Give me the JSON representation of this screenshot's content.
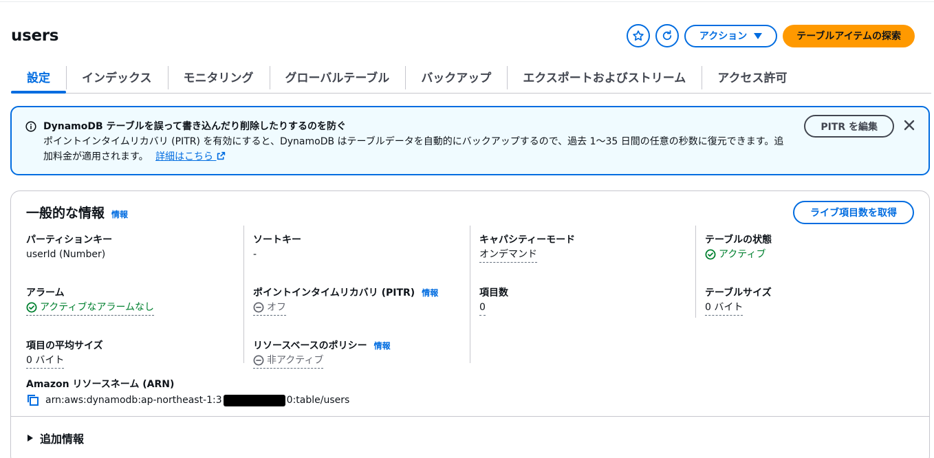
{
  "page": {
    "title": "users"
  },
  "header": {
    "favorite_icon": "star-icon",
    "refresh_icon": "refresh-icon",
    "actions_label": "アクション",
    "explore_label": "テーブルアイテムの探索"
  },
  "tabs": [
    {
      "label": "設定",
      "active": true
    },
    {
      "label": "インデックス"
    },
    {
      "label": "モニタリング"
    },
    {
      "label": "グローバルテーブル"
    },
    {
      "label": "バックアップ"
    },
    {
      "label": "エクスポートおよびストリーム"
    },
    {
      "label": "アクセス許可"
    }
  ],
  "alert": {
    "title": "DynamoDB テーブルを誤って書き込んだり削除したりするのを防ぐ",
    "body": "ポイントインタイムリカバリ (PITR) を有効にすると、DynamoDB はテーブルデータを自動的にバックアップするので、過去 1〜35 日間の任意の秒数に復元できます。追加料金が適用されます。",
    "link": "詳細はこちら",
    "edit_button": "PITR を編集"
  },
  "general": {
    "title": "一般的な情報",
    "info": "情報",
    "live_count_button": "ライブ項目数を取得",
    "partition_key_label": "パーティションキー",
    "partition_key_value": "userId (Number)",
    "alarms_label": "アラーム",
    "alarms_value": "アクティブなアラームなし",
    "avg_size_label": "項目の平均サイズ",
    "avg_size_value": "0 バイト",
    "sort_key_label": "ソートキー",
    "sort_key_value": "-",
    "pitr_label": "ポイントインタイムリカバリ (PITR)",
    "pitr_info": "情報",
    "pitr_value": "オフ",
    "policy_label": "リソースベースのポリシー",
    "policy_info": "情報",
    "policy_value": "非アクティブ",
    "capacity_label": "キャパシティーモード",
    "capacity_value": "オンデマンド",
    "item_count_label": "項目数",
    "item_count_value": "0",
    "status_label": "テーブルの状態",
    "status_value": "アクティブ",
    "table_size_label": "テーブルサイズ",
    "table_size_value": "0 バイト",
    "arn_label": "Amazon リソースネーム (ARN)",
    "arn_prefix": "arn:aws:dynamodb:ap-northeast-1:3",
    "arn_suffix": "0:table/users",
    "additional_info": "追加情報"
  },
  "colors": {
    "accent": "#006ce0",
    "primary_button": "#ff9900",
    "success": "#00802f",
    "alert_bg": "#f0fbff"
  }
}
